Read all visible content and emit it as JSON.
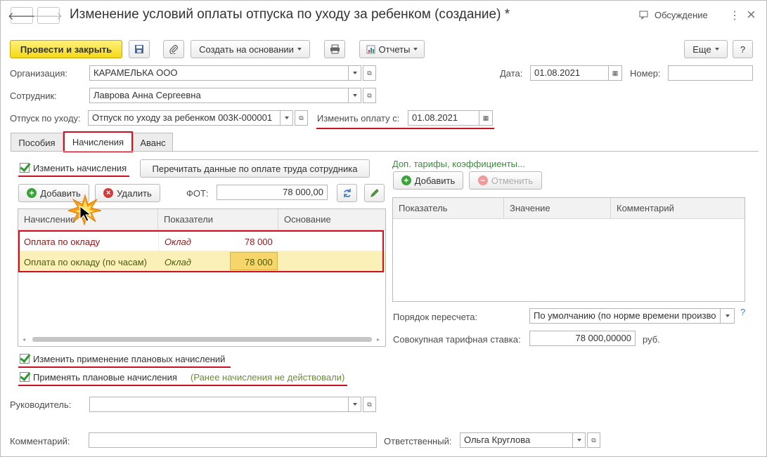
{
  "title": "Изменение условий оплаты отпуска по уходу за ребенком (создание) *",
  "nav": {
    "back": "🡐",
    "forward": "🡒"
  },
  "header": {
    "discussion": "Обсуждение",
    "menu": "⋮",
    "close": "×"
  },
  "toolbar": {
    "post_close": "Провести и закрыть",
    "create_based": "Создать на основании",
    "reports": "Отчеты",
    "more": "Еще",
    "help": "?"
  },
  "form": {
    "org_label": "Организация:",
    "org_value": "КАРАМЕЛЬКА ООО",
    "date_label": "Дата:",
    "date_value": "01.08.2021",
    "number_label": "Номер:",
    "number_value": "",
    "employee_label": "Сотрудник:",
    "employee_value": "Лаврова Анна Сергеевна",
    "leave_label": "Отпуск по уходу:",
    "leave_value": "Отпуск по уходу за ребенком 003К-000001",
    "change_pay_label": "Изменить оплату с:",
    "change_pay_value": "01.08.2021"
  },
  "tabs": [
    "Пособия",
    "Начисления",
    "Аванс"
  ],
  "accruals": {
    "change_label": "Изменить начисления",
    "reread_button": "Перечитать данные по оплате труда сотрудника",
    "add_button": "Добавить",
    "delete_button": "Удалить",
    "fot_label": "ФОТ:",
    "fot_value": "78 000,00",
    "columns": [
      "Начисление",
      "Показатели",
      "Основание"
    ],
    "rows": [
      {
        "name": "Оплата по окладу",
        "indicator": "Оклад",
        "value": "78 000"
      },
      {
        "name": "Оплата по окладу (по часам)",
        "indicator": "Оклад",
        "value": "78 000"
      }
    ]
  },
  "tariffs": {
    "link": "Доп. тарифы, коэффициенты...",
    "add_button": "Добавить",
    "cancel_button": "Отменить",
    "columns": [
      "Показатель",
      "Значение",
      "Комментарий"
    ],
    "recalc_label": "Порядок пересчета:",
    "recalc_value": "По умолчанию (по норме времени произво",
    "rate_label": "Совокупная тарифная ставка:",
    "rate_value": "78 000,00000",
    "rate_unit": "руб.",
    "help": "?"
  },
  "planned": {
    "change_label": "Изменить применение плановых начислений",
    "apply_label": "Применять плановые начисления",
    "apply_note": "(Ранее начисления не действовали)"
  },
  "footer": {
    "manager_label": "Руководитель:",
    "manager_value": "",
    "comment_label": "Комментарий:",
    "comment_value": "",
    "responsible_label": "Ответственный:",
    "responsible_value": "Ольга Круглова"
  },
  "colors": {
    "accent_yellow": "#f5d917",
    "highlight_red": "#d01020",
    "check_green": "#2a9a2a",
    "row_selected": "#fbf0b8",
    "link_green": "#3c8b3c"
  }
}
